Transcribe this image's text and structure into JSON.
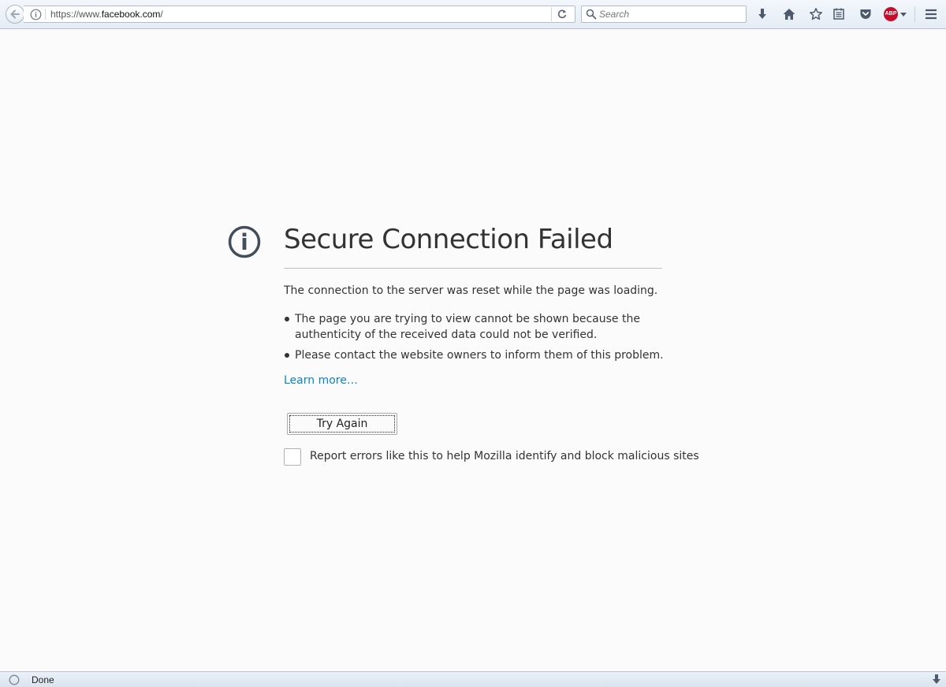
{
  "browser": {
    "url_scheme": "https://www.",
    "url_host": "facebook.com",
    "url_path": "/",
    "search_placeholder": "Search",
    "abp_label": "ABP"
  },
  "error": {
    "title": "Secure Connection Failed",
    "description": "The connection to the server was reset while the page was loading.",
    "bullets": [
      "The page you are trying to view cannot be shown because the authenticity of the received data could not be verified.",
      "Please contact the website owners to inform them of this problem."
    ],
    "learn_more": "Learn more…",
    "try_again": "Try Again",
    "report_label": "Report errors like this to help Mozilla identify and block malicious sites",
    "report_checked": false
  },
  "status": {
    "text": "Done"
  },
  "colors": {
    "link": "#0a84c9",
    "icon": "#4c5a6b",
    "abp_red": "#c70d2c",
    "page_bg": "#fbfbfb"
  },
  "icons": [
    "back-arrow-icon",
    "info-icon",
    "reload-icon",
    "search-icon",
    "download-icon",
    "home-icon",
    "bookmark-star-icon",
    "reading-list-icon",
    "pocket-icon",
    "adblock-plus-icon",
    "hamburger-menu-icon",
    "error-info-icon"
  ]
}
